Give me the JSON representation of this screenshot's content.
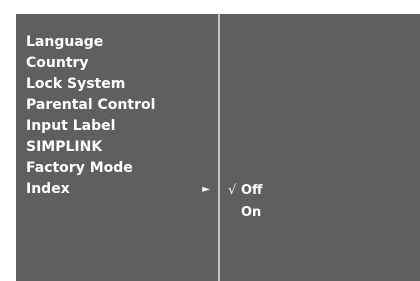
{
  "menu": {
    "items": [
      {
        "label": "Language"
      },
      {
        "label": "Country"
      },
      {
        "label": "Lock System"
      },
      {
        "label": "Parental Control"
      },
      {
        "label": "Input Label"
      },
      {
        "label": "SIMPLINK"
      },
      {
        "label": "Factory Mode"
      },
      {
        "label": "Index",
        "selected": true
      }
    ],
    "arrow_icon": "►"
  },
  "submenu": {
    "items": [
      {
        "label": "Off",
        "check": "√",
        "checked": true
      },
      {
        "label": "On",
        "check": "",
        "checked": false
      }
    ]
  },
  "colors": {
    "background": "#5f5f5f",
    "divider": "#c4c4c4",
    "text": "#ffffff"
  }
}
